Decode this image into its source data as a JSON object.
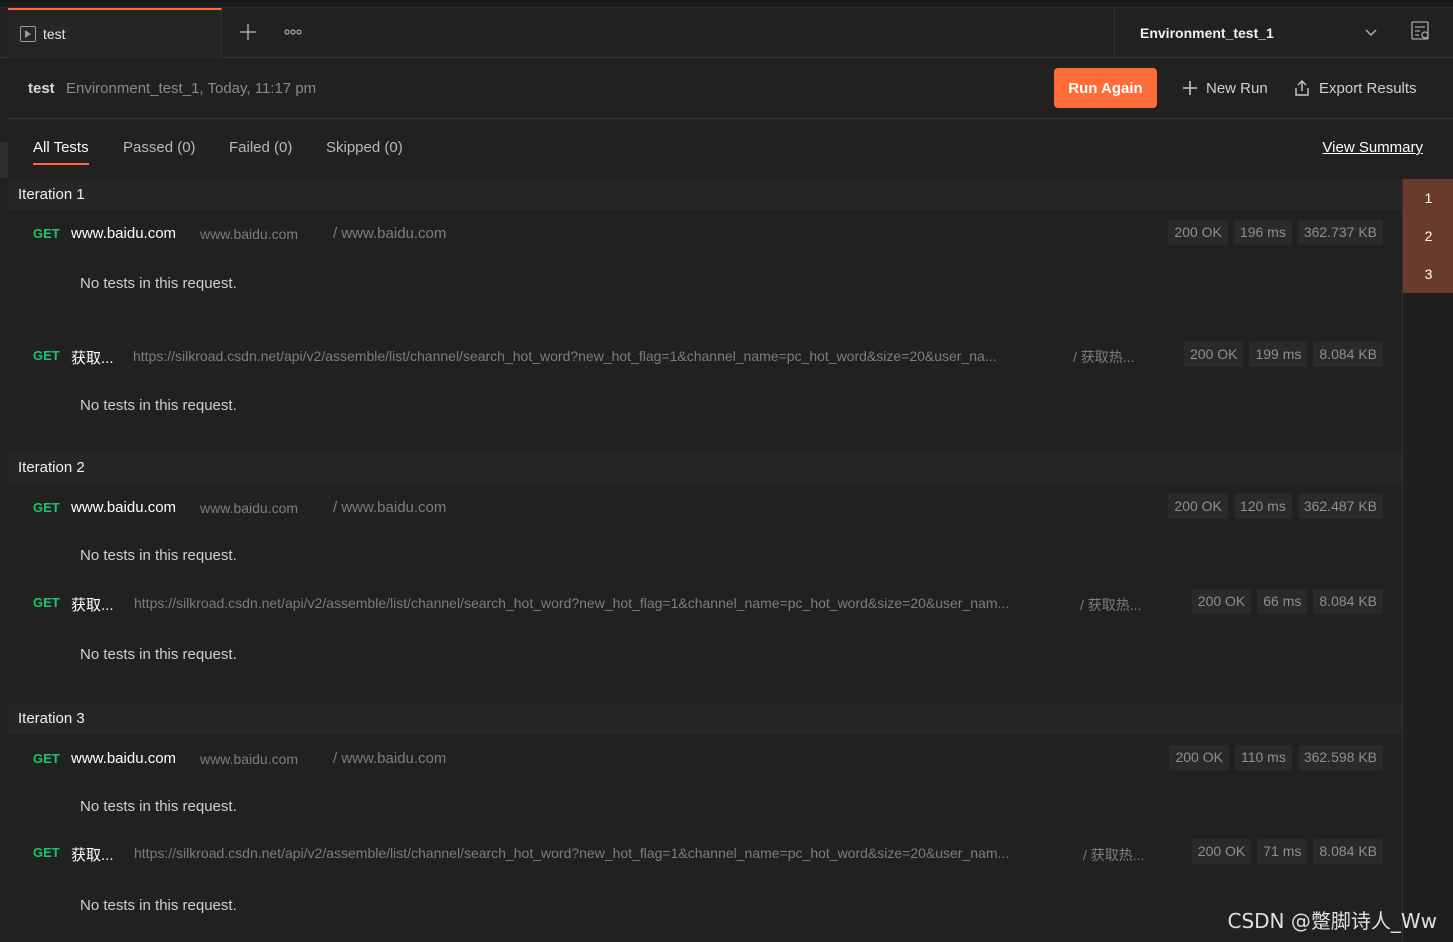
{
  "tabbar": {
    "tab_title": "test",
    "environment": "Environment_test_1"
  },
  "run": {
    "name": "test",
    "meta": "Environment_test_1, Today, 11:17 pm",
    "run_again_label": "Run Again",
    "new_run_label": "New Run",
    "export_label": "Export Results"
  },
  "filters": {
    "all": "All Tests",
    "passed": "Passed (0)",
    "failed": "Failed (0)",
    "skipped": "Skipped (0)",
    "view_summary": "View Summary"
  },
  "no_tests_text": "No tests in this request.",
  "iterations": [
    {
      "title": "Iteration 1",
      "requests": [
        {
          "method": "GET",
          "name": "www.baidu.com",
          "url": "www.baidu.com",
          "path": "/ www.baidu.com",
          "status": "200 OK",
          "time": "196 ms",
          "size": "362.737 KB"
        },
        {
          "method": "GET",
          "name": "获取...",
          "url": "https://silkroad.csdn.net/api/v2/assemble/list/channel/search_hot_word?new_hot_flag=1&channel_name=pc_hot_word&size=20&user_na...",
          "path": "/ 获取热...",
          "status": "200 OK",
          "time": "199 ms",
          "size": "8.084 KB"
        }
      ]
    },
    {
      "title": "Iteration 2",
      "requests": [
        {
          "method": "GET",
          "name": "www.baidu.com",
          "url": "www.baidu.com",
          "path": "/ www.baidu.com",
          "status": "200 OK",
          "time": "120 ms",
          "size": "362.487 KB"
        },
        {
          "method": "GET",
          "name": "获取...",
          "url": "https://silkroad.csdn.net/api/v2/assemble/list/channel/search_hot_word?new_hot_flag=1&channel_name=pc_hot_word&size=20&user_nam...",
          "path": "/ 获取热...",
          "status": "200 OK",
          "time": "66 ms",
          "size": "8.084 KB"
        }
      ]
    },
    {
      "title": "Iteration 3",
      "requests": [
        {
          "method": "GET",
          "name": "www.baidu.com",
          "url": "www.baidu.com",
          "path": "/ www.baidu.com",
          "status": "200 OK",
          "time": "110 ms",
          "size": "362.598 KB"
        },
        {
          "method": "GET",
          "name": "获取...",
          "url": "https://silkroad.csdn.net/api/v2/assemble/list/channel/search_hot_word?new_hot_flag=1&channel_name=pc_hot_word&size=20&user_nam...",
          "path": "/ 获取热...",
          "status": "200 OK",
          "time": "71 ms",
          "size": "8.084 KB"
        }
      ]
    }
  ],
  "scrubber": [
    "1",
    "2",
    "3"
  ],
  "watermark": "CSDN @蹩脚诗人_Ww",
  "colors": {
    "accent": "#ff6c37",
    "method_get": "#1ec36e",
    "scrubber_active": "#6a3a2a"
  }
}
